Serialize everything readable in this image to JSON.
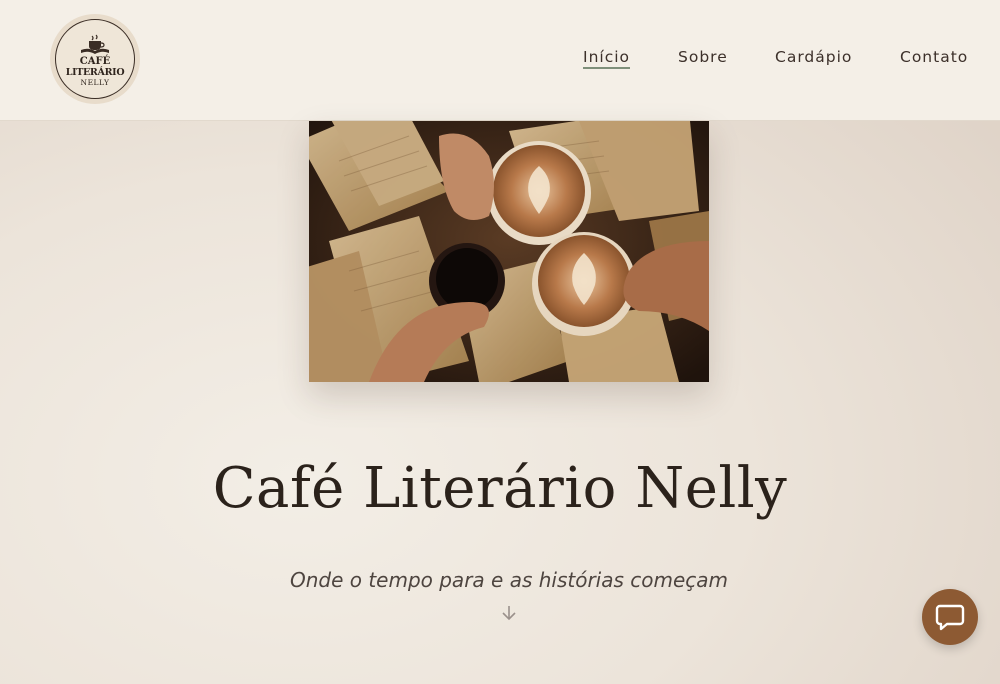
{
  "brand": {
    "logo_line1": "CAFÉ",
    "logo_line2": "LITERÁRIO",
    "logo_line3": "NELLY"
  },
  "nav": {
    "items": [
      {
        "label": "Início",
        "active": true
      },
      {
        "label": "Sobre"
      },
      {
        "label": "Cardápio"
      },
      {
        "label": "Contato"
      }
    ]
  },
  "hero": {
    "title": "Café Literário Nelly",
    "subtitle": "Onde o tempo para e as histórias começam",
    "image_icon": "coffee-cups-and-books-photo"
  },
  "icons": {
    "scroll": "arrow-down-icon",
    "chat": "chat-bubble-icon"
  },
  "colors": {
    "accent": "#8d5a33",
    "nav_active_underline": "#7e8f7a",
    "header_bg": "#f4efe7",
    "title": "#2b221b"
  }
}
